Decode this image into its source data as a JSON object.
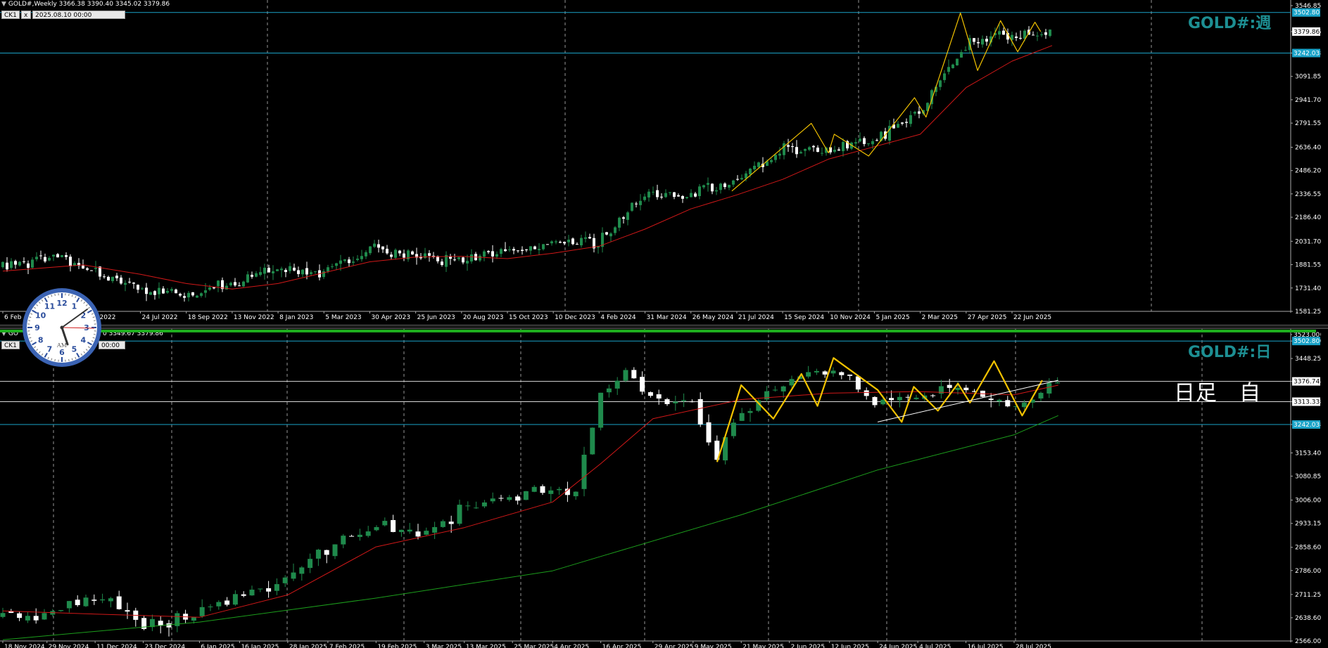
{
  "top": {
    "header": "GOLD#,Weekly  3366.38 3390.40 3345.02 3379.86",
    "tag_left": "CK1",
    "tag_x": "x",
    "tag_date": "2025.08.10 00:00",
    "symbol_title": "GOLD#:週"
  },
  "bottom": {
    "header_prefix": "GO",
    "header_suffix": "0 3349.67 3379.86",
    "tag_left": "CK1",
    "tag_date": "00:00",
    "symbol_title": "GOLD#:日",
    "note": "日足　自"
  },
  "clock": {
    "am_label": "AM"
  },
  "colors": {
    "background": "#000000",
    "bull_candle": "#1f8a4c",
    "bear_candle": "#ffffff",
    "ma_red": "#d01818",
    "ma_green": "#1c9e1c",
    "zigzag": "#f2c200",
    "hline_blue": "#1aa3c8",
    "hline_white": "#d8d8d8",
    "title_teal": "#1d8f93",
    "price_tag_blue": "#1aa3c8"
  },
  "chart_data": [
    {
      "type": "candlestick",
      "title": "GOLD#,Weekly",
      "timeframe": "Weekly",
      "ohlc_last": {
        "open": 3366.38,
        "high": 3390.4,
        "low": 3345.02,
        "close": 3379.86
      },
      "ylim": [
        1581.25,
        3546.85
      ],
      "y_ticks": [
        3546.85,
        3379.86,
        3242.03,
        3091.85,
        2941.7,
        2791.55,
        2636.4,
        2486.2,
        2336.55,
        2186.4,
        2031.7,
        1881.55,
        1731.4,
        1581.25
      ],
      "x_ticks": [
        "6 Feb",
        "May 2022",
        "24 Jul 2022",
        "18 Sep 2022",
        "13 Nov 2022",
        "8 Jan 2023",
        "5 Mar 2023",
        "30 Apr 2023",
        "25 Jun 2023",
        "20 Aug 2023",
        "15 Oct 2023",
        "10 Dec 2023",
        "4 Feb 2024",
        "31 Mar 2024",
        "26 May 2024",
        "21 Jul 2024",
        "15 Sep 2024",
        "10 Nov 2024",
        "5 Jan 2025",
        "2 Mar 2025",
        "27 Apr 2025",
        "22 Jun 2025"
      ],
      "hlines": [
        3502.8,
        3242.03
      ],
      "price_tags": [
        {
          "value": "3502.80"
        },
        {
          "value": "3379.86"
        },
        {
          "value": "3242.03"
        }
      ],
      "close_path": [
        {
          "x": "6 Feb",
          "y": 1870
        },
        {
          "x": "Apr 2022",
          "y": 1935
        },
        {
          "x": "May 2022",
          "y": 1850
        },
        {
          "x": "24 Jul 2022",
          "y": 1730
        },
        {
          "x": "18 Sep 2022",
          "y": 1670
        },
        {
          "x": "13 Nov 2022",
          "y": 1760
        },
        {
          "x": "8 Jan 2023",
          "y": 1865
        },
        {
          "x": "5 Mar 2023",
          "y": 1830
        },
        {
          "x": "30 Apr 2023",
          "y": 1990
        },
        {
          "x": "25 Jun 2023",
          "y": 1925
        },
        {
          "x": "20 Aug 2023",
          "y": 1900
        },
        {
          "x": "15 Oct 2023",
          "y": 1985
        },
        {
          "x": "10 Dec 2023",
          "y": 2010
        },
        {
          "x": "4 Feb 2024",
          "y": 2030
        },
        {
          "x": "31 Mar 2024",
          "y": 2330
        },
        {
          "x": "26 May 2024",
          "y": 2330
        },
        {
          "x": "21 Jul 2024",
          "y": 2420
        },
        {
          "x": "15 Sep 2024",
          "y": 2620
        },
        {
          "x": "10 Nov 2024",
          "y": 2620
        },
        {
          "x": "5 Jan 2025",
          "y": 2680
        },
        {
          "x": "2 Mar 2025",
          "y": 2860
        },
        {
          "x": "27 Apr 2025",
          "y": 3310
        },
        {
          "x": "22 Jun 2025",
          "y": 3370
        },
        {
          "x": "10 Aug 2025",
          "y": 3379.86
        }
      ],
      "ma_red": [
        {
          "x": "6 Feb",
          "y": 1840
        },
        {
          "x": "May 2022",
          "y": 1880
        },
        {
          "x": "24 Jul 2022",
          "y": 1820
        },
        {
          "x": "18 Sep 2022",
          "y": 1760
        },
        {
          "x": "13 Nov 2022",
          "y": 1725
        },
        {
          "x": "8 Jan 2023",
          "y": 1760
        },
        {
          "x": "5 Mar 2023",
          "y": 1830
        },
        {
          "x": "30 Apr 2023",
          "y": 1900
        },
        {
          "x": "25 Jun 2023",
          "y": 1930
        },
        {
          "x": "20 Aug 2023",
          "y": 1935
        },
        {
          "x": "15 Oct 2023",
          "y": 1920
        },
        {
          "x": "10 Dec 2023",
          "y": 1955
        },
        {
          "x": "4 Feb 2024",
          "y": 2000
        },
        {
          "x": "31 Mar 2024",
          "y": 2110
        },
        {
          "x": "26 May 2024",
          "y": 2240
        },
        {
          "x": "21 Jul 2024",
          "y": 2330
        },
        {
          "x": "15 Sep 2024",
          "y": 2430
        },
        {
          "x": "10 Nov 2024",
          "y": 2560
        },
        {
          "x": "5 Jan 2025",
          "y": 2640
        },
        {
          "x": "2 Mar 2025",
          "y": 2720
        },
        {
          "x": "27 Apr 2025",
          "y": 3020
        },
        {
          "x": "22 Jun 2025",
          "y": 3190
        },
        {
          "x": "10 Aug 2025",
          "y": 3290
        }
      ],
      "zigzag": [
        {
          "x": "15 Jul 2024",
          "y": 2355
        },
        {
          "x": "20 Oct 2024",
          "y": 2790
        },
        {
          "x": "10 Nov 2024",
          "y": 2600
        },
        {
          "x": "17 Nov 2024",
          "y": 2720
        },
        {
          "x": "29 Dec 2024",
          "y": 2580
        },
        {
          "x": "23 Feb 2025",
          "y": 2955
        },
        {
          "x": "9 Mar 2025",
          "y": 2830
        },
        {
          "x": "20 Apr 2025",
          "y": 3500
        },
        {
          "x": "11 May 2025",
          "y": 3130
        },
        {
          "x": "8 Jun 2025",
          "y": 3450
        },
        {
          "x": "29 Jun 2025",
          "y": 3250
        },
        {
          "x": "20 Jul 2025",
          "y": 3440
        },
        {
          "x": "27 Jul 2025",
          "y": 3380
        }
      ]
    },
    {
      "type": "candlestick",
      "title": "GOLD#,Daily",
      "timeframe": "Daily",
      "ohlc_last": {
        "close": 3379.86
      },
      "ylim": [
        2566.0,
        3523.0
      ],
      "y_ticks": [
        3523.0,
        3502.8,
        3448.25,
        3376.74,
        3313.33,
        3242.03,
        3153.4,
        3080.85,
        3006.0,
        2933.15,
        2858.6,
        2786.0,
        2711.25,
        2638.6,
        2566.0
      ],
      "x_ticks": [
        "18 Nov 2024",
        "29 Nov 2024",
        "11 Dec 2024",
        "23 Dec 2024",
        "6 Jan 2025",
        "16 Jan 2025",
        "28 Jan 2025",
        "7 Feb 2025",
        "19 Feb 2025",
        "3 Mar 2025",
        "13 Mar 2025",
        "25 Mar 2025",
        "4 Apr 2025",
        "16 Apr 2025",
        "29 Apr 2025",
        "9 May 2025",
        "21 May 2025",
        "2 Jun 2025",
        "12 Jun 2025",
        "24 Jun 2025",
        "4 Jul 2025",
        "16 Jul 2025",
        "28 Jul 2025"
      ],
      "hlines": [
        3502.8,
        3376.74,
        3313.33,
        3242.03
      ],
      "price_tags": [
        {
          "value": "3523.00"
        },
        {
          "value": "3502.80"
        },
        {
          "value": "3376.74"
        },
        {
          "value": "3313.33"
        },
        {
          "value": "3242.03"
        }
      ],
      "close_path": [
        {
          "x": "18 Nov 2024",
          "y": 2640
        },
        {
          "x": "29 Nov 2024",
          "y": 2655
        },
        {
          "x": "11 Dec 2024",
          "y": 2710
        },
        {
          "x": "23 Dec 2024",
          "y": 2620
        },
        {
          "x": "6 Jan 2025",
          "y": 2650
        },
        {
          "x": "16 Jan 2025",
          "y": 2710
        },
        {
          "x": "28 Jan 2025",
          "y": 2765
        },
        {
          "x": "7 Feb 2025",
          "y": 2860
        },
        {
          "x": "19 Feb 2025",
          "y": 2935
        },
        {
          "x": "3 Mar 2025",
          "y": 2890
        },
        {
          "x": "13 Mar 2025",
          "y": 2985
        },
        {
          "x": "25 Mar 2025",
          "y": 3020
        },
        {
          "x": "4 Apr 2025",
          "y": 3040
        },
        {
          "x": "9 Apr 2025",
          "y": 3000
        },
        {
          "x": "16 Apr 2025",
          "y": 3340
        },
        {
          "x": "22 Apr 2025",
          "y": 3420
        },
        {
          "x": "29 Apr 2025",
          "y": 3320
        },
        {
          "x": "9 May 2025",
          "y": 3300
        },
        {
          "x": "15 May 2025",
          "y": 3150
        },
        {
          "x": "21 May 2025",
          "y": 3290
        },
        {
          "x": "2 Jun 2025",
          "y": 3380
        },
        {
          "x": "12 Jun 2025",
          "y": 3410
        },
        {
          "x": "24 Jun 2025",
          "y": 3320
        },
        {
          "x": "4 Jul 2025",
          "y": 3340
        },
        {
          "x": "16 Jul 2025",
          "y": 3345
        },
        {
          "x": "28 Jul 2025",
          "y": 3300
        },
        {
          "x": "8 Aug 2025",
          "y": 3379.86
        }
      ],
      "ma_red": [
        {
          "x": "18 Nov 2024",
          "y": 2660
        },
        {
          "x": "11 Dec 2024",
          "y": 2650
        },
        {
          "x": "6 Jan 2025",
          "y": 2640
        },
        {
          "x": "28 Jan 2025",
          "y": 2710
        },
        {
          "x": "19 Feb 2025",
          "y": 2860
        },
        {
          "x": "13 Mar 2025",
          "y": 2920
        },
        {
          "x": "4 Apr 2025",
          "y": 3000
        },
        {
          "x": "16 Apr 2025",
          "y": 3120
        },
        {
          "x": "29 Apr 2025",
          "y": 3260
        },
        {
          "x": "21 May 2025",
          "y": 3320
        },
        {
          "x": "12 Jun 2025",
          "y": 3340
        },
        {
          "x": "4 Jul 2025",
          "y": 3345
        },
        {
          "x": "28 Jul 2025",
          "y": 3335
        },
        {
          "x": "8 Aug 2025",
          "y": 3365
        }
      ],
      "ma_green": [
        {
          "x": "18 Nov 2024",
          "y": 2570
        },
        {
          "x": "6 Jan 2025",
          "y": 2625
        },
        {
          "x": "19 Feb 2025",
          "y": 2700
        },
        {
          "x": "4 Apr 2025",
          "y": 2785
        },
        {
          "x": "16 Apr 2025",
          "y": 2830
        },
        {
          "x": "21 May 2025",
          "y": 2960
        },
        {
          "x": "24 Jun 2025",
          "y": 3100
        },
        {
          "x": "28 Jul 2025",
          "y": 3210
        },
        {
          "x": "8 Aug 2025",
          "y": 3270
        }
      ],
      "zigzag": [
        {
          "x": "15 May 2025",
          "y": 3125
        },
        {
          "x": "21 May 2025",
          "y": 3365
        },
        {
          "x": "29 May 2025",
          "y": 3260
        },
        {
          "x": "5 Jun 2025",
          "y": 3400
        },
        {
          "x": "9 Jun 2025",
          "y": 3300
        },
        {
          "x": "13 Jun 2025",
          "y": 3450
        },
        {
          "x": "24 Jun 2025",
          "y": 3350
        },
        {
          "x": "30 Jun 2025",
          "y": 3250
        },
        {
          "x": "3 Jul 2025",
          "y": 3360
        },
        {
          "x": "9 Jul 2025",
          "y": 3285
        },
        {
          "x": "14 Jul 2025",
          "y": 3370
        },
        {
          "x": "17 Jul 2025",
          "y": 3310
        },
        {
          "x": "23 Jul 2025",
          "y": 3440
        },
        {
          "x": "30 Jul 2025",
          "y": 3270
        },
        {
          "x": "4 Aug 2025",
          "y": 3380
        }
      ],
      "trendline": [
        {
          "x": "24 Jun 2025",
          "y": 3250
        },
        {
          "x": "8 Aug 2025",
          "y": 3380
        }
      ]
    }
  ]
}
